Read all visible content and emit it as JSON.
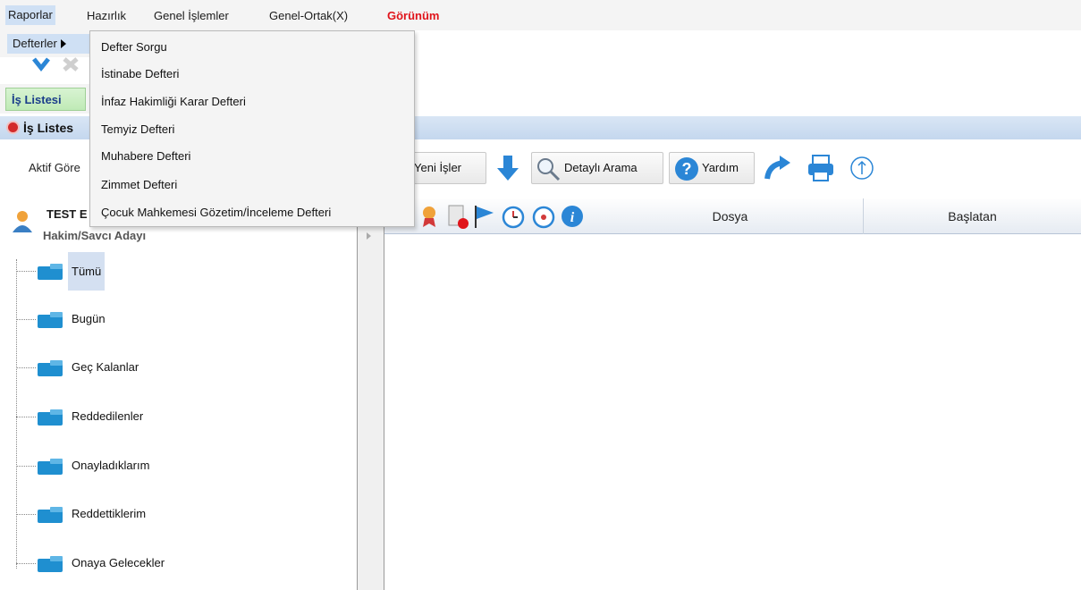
{
  "menubar": {
    "items": [
      {
        "label": "Raporlar",
        "active": true
      },
      {
        "label": "Hazırlık",
        "active": false
      },
      {
        "label": "Genel İşlemler",
        "active": false
      },
      {
        "label": "Genel-Ortak(X)",
        "active": false
      },
      {
        "label": "Görünüm",
        "active": false,
        "color": "#e0141b"
      }
    ]
  },
  "submenu": {
    "defterler_label": "Defterler"
  },
  "popup": {
    "items": [
      "Defter Sorgu",
      "İstinabe Defteri",
      "İnfaz Hakimliği Karar Defteri",
      "Temyiz Defteri",
      "Muhabere Defteri",
      "Zimmet Defteri",
      "Çocuk Mahkemesi Gözetim/İnceleme Defteri"
    ]
  },
  "tabs": {
    "is_listesi": "İş Listesi"
  },
  "title_bar": {
    "title": "İş Listes"
  },
  "toolbar": {
    "aktif_label": "Aktif Göre",
    "yeni_isler": "Yeni İşler",
    "detayli_arama": "Detaylı Arama",
    "yardim": "Yardım"
  },
  "tree": {
    "user_name": "TEST E",
    "user_role": "Hakim/Savcı Adayı",
    "nodes": [
      "Tümü",
      "Bugün",
      "Geç Kalanlar",
      "Reddedilenler",
      "Onayladıklarım",
      "Reddettiklerim",
      "Onaya Gelecekler"
    ],
    "selected": "Tümü"
  },
  "table": {
    "columns": [
      "Dosya",
      "Başlatan"
    ]
  },
  "colors": {
    "accent_blue": "#2b86d6",
    "menu_red": "#e0141b",
    "tab_green": "#bfeab6"
  }
}
